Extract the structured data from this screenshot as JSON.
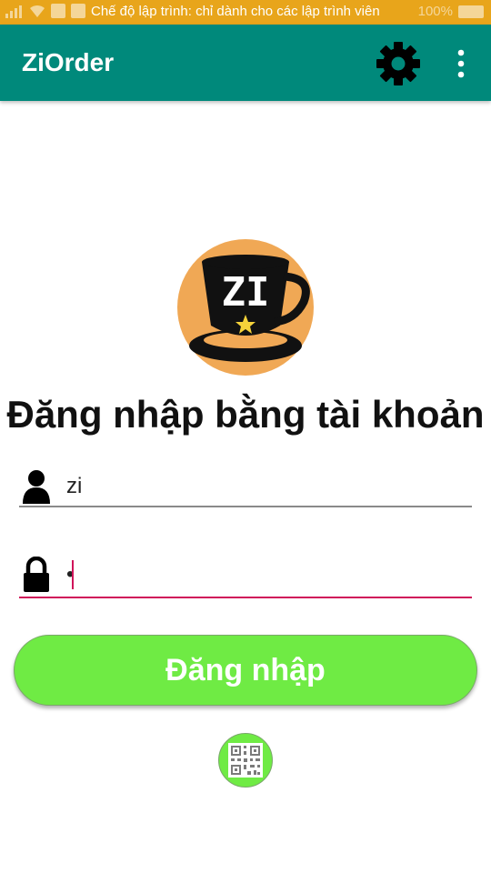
{
  "status_bar": {
    "notice": "Chế độ lập trình: chỉ dành cho các lập trình viên",
    "battery": "100%"
  },
  "app_bar": {
    "title": "ZiOrder",
    "settings_icon": "gear-icon",
    "overflow_icon": "more-vert-icon"
  },
  "logo": {
    "text": "ZI",
    "icon": "coffee-cup-logo"
  },
  "login": {
    "heading": "Đăng nhập bằng tài khoản",
    "username": {
      "value": "zi",
      "icon": "person-icon"
    },
    "password": {
      "value": "•",
      "icon": "lock-icon"
    },
    "submit_label": "Đăng nhập",
    "qr_icon": "qr-code-icon"
  },
  "colors": {
    "app_bar": "#00897b",
    "status_bar": "#e8a51b",
    "button": "#6feb44",
    "focus_underline": "#d0145a"
  }
}
